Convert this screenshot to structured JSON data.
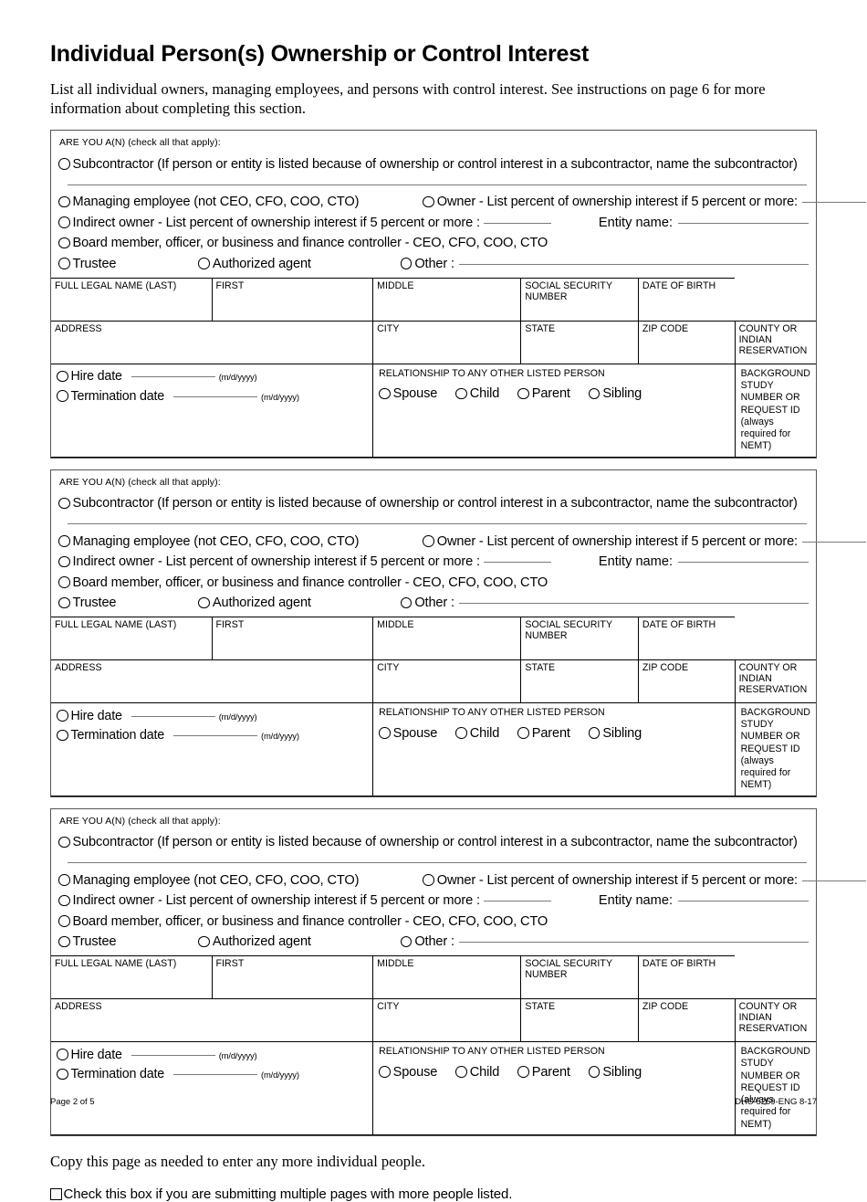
{
  "page": {
    "title": "Individual Person(s) Ownership or Control Interest",
    "intro": "List all individual owners, managing employees, and persons with control interest. See instructions on page 6 for more information about completing this section.",
    "copy_note": "Copy this page as needed to enter any more individual people.",
    "multiple_pages_label": "Check this box if you are submitting multiple pages with more people listed.",
    "footer_left": "Page 2 of 5",
    "footer_right": "DHS-5259-ENG  8-17"
  },
  "block": {
    "heading": "ARE YOU A(N) (check all that apply):",
    "options": {
      "subcontractor": "Subcontractor (If person or entity is listed because of ownership or control interest in a subcontractor, name the subcontractor)",
      "managing_employee": "Managing employee (not CEO, CFO, COO, CTO)",
      "owner": "Owner - List percent of ownership interest if 5 percent or more:",
      "indirect_owner": "Indirect owner - List percent of ownership interest if 5 percent or more :",
      "entity_name": "Entity name:",
      "board_member": "Board member, officer, or business and finance controller - CEO, CFO, COO, CTO",
      "trustee": "Trustee",
      "authorized_agent": "Authorized agent",
      "other": "Other :"
    },
    "fields": {
      "full_legal_name_last": "FULL LEGAL NAME (LAST)",
      "first": "FIRST",
      "middle": "MIDDLE",
      "social_security_number": "SOCIAL SECURITY NUMBER",
      "date_of_birth": "DATE OF BIRTH",
      "address": "ADDRESS",
      "city": "CITY",
      "state": "STATE",
      "zip_code": "ZIP CODE",
      "county_or_indian_reservation": "COUNTY OR INDIAN RESERVATION",
      "hire_date": "Hire date",
      "termination_date": "Termination date",
      "date_format": "(m/d/yyyy)",
      "relationship_heading": "RELATIONSHIP TO ANY OTHER LISTED PERSON",
      "relationship_options": [
        "Spouse",
        "Child",
        "Parent",
        "Sibling"
      ],
      "background_study_line1": "BACKGROUND STUDY NUMBER OR REQUEST ID",
      "background_study_line2": "(always required for NEMT)"
    }
  },
  "blocks_count": 3
}
